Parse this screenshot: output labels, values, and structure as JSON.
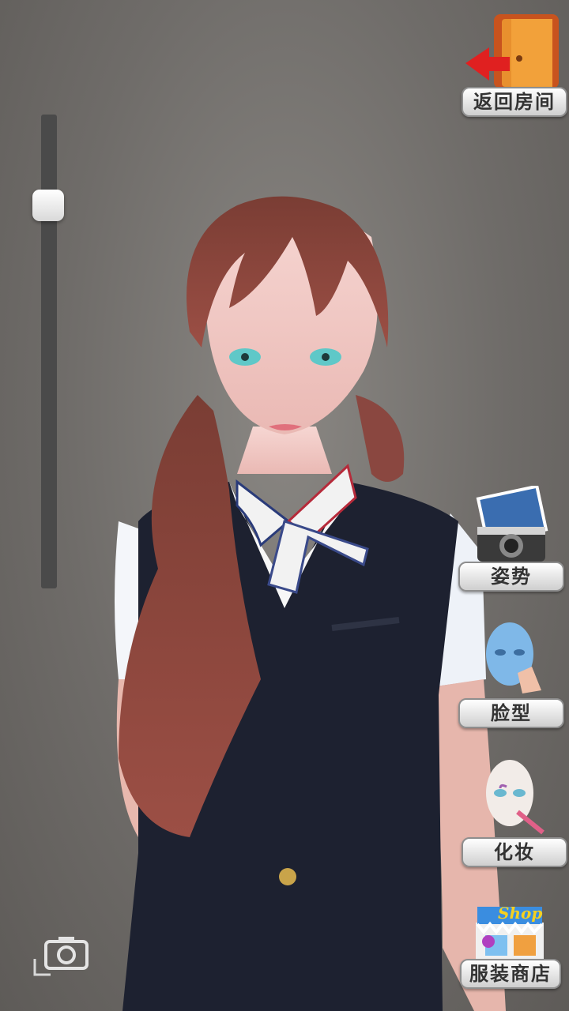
{
  "top_right": {
    "back_label": "返回房间"
  },
  "menu": {
    "pose_label": "姿势",
    "face_label": "脸型",
    "makeup_label": "化妆",
    "shop_label": "服装商店",
    "shop_sign": "Shop"
  },
  "slider": {
    "value": 0.17
  },
  "icons": {
    "back": "exit-door-icon",
    "pose": "camera-photo-icon",
    "face": "face-head-icon",
    "makeup": "makeup-brush-icon",
    "shop": "shop-storefront-icon",
    "screenshot": "camera-icon"
  }
}
